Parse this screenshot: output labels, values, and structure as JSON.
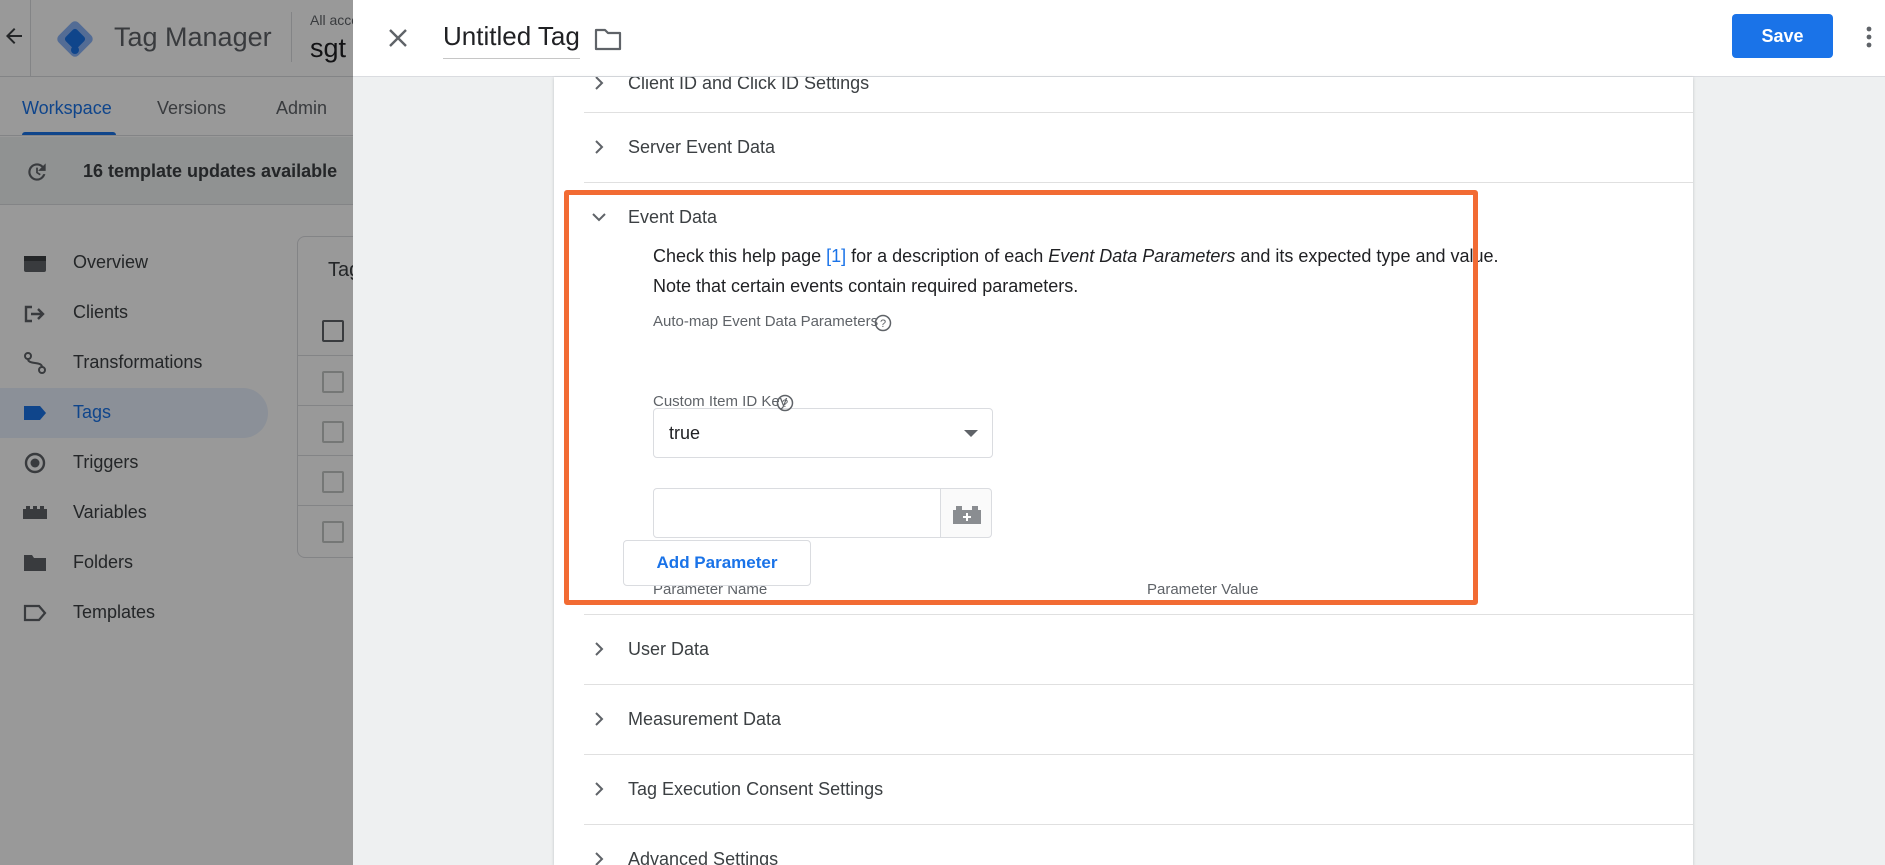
{
  "background_app": {
    "product_name": "Tag Manager",
    "account_label": "All acco",
    "container_name": "sgt",
    "tabs": [
      {
        "label": "Workspace"
      },
      {
        "label": "Versions"
      },
      {
        "label": "Admin"
      }
    ],
    "updates_banner": "16 template updates available",
    "sidebar": [
      {
        "label": "Overview",
        "icon": "overview-icon"
      },
      {
        "label": "Clients",
        "icon": "clients-icon"
      },
      {
        "label": "Transformations",
        "icon": "transformations-icon"
      },
      {
        "label": "Tags",
        "icon": "tag-icon"
      },
      {
        "label": "Triggers",
        "icon": "triggers-icon"
      },
      {
        "label": "Variables",
        "icon": "variables-icon"
      },
      {
        "label": "Folders",
        "icon": "folder-icon"
      },
      {
        "label": "Templates",
        "icon": "templates-icon"
      }
    ],
    "tags_card_title": "Tag",
    "colors": {
      "brand_blue": "#1a73e8",
      "active_nav_bg": "#e8f0fe"
    }
  },
  "sheet": {
    "title": "Untitled Tag",
    "save_label": "Save",
    "colors": {
      "highlight": "#f26b33",
      "primary": "#1a73e8"
    }
  },
  "sections": {
    "client_id": "Client ID and Click ID Settings",
    "server_event_data": "Server Event Data",
    "event_data": {
      "label": "Event Data",
      "help_line1_before": "Check this help page ",
      "help_link": "[1]",
      "help_line1_mid": " for a description of each ",
      "help_line1_em": "Event Data Parameters",
      "help_line1_after": " and its expected type and value.",
      "help_line2": "Note that certain events contain required parameters.",
      "automap_label": "Auto-map Event Data Parameters",
      "automap_value": "true",
      "custom_item_label": "Custom Item ID Key",
      "custom_item_value": "",
      "param_name_header": "Parameter Name",
      "param_value_header": "Parameter Value",
      "add_param_label": "Add Parameter"
    },
    "user_data": "User Data",
    "measurement_data": "Measurement Data",
    "consent_settings": "Tag Execution Consent Settings",
    "advanced_settings": "Advanced Settings"
  }
}
